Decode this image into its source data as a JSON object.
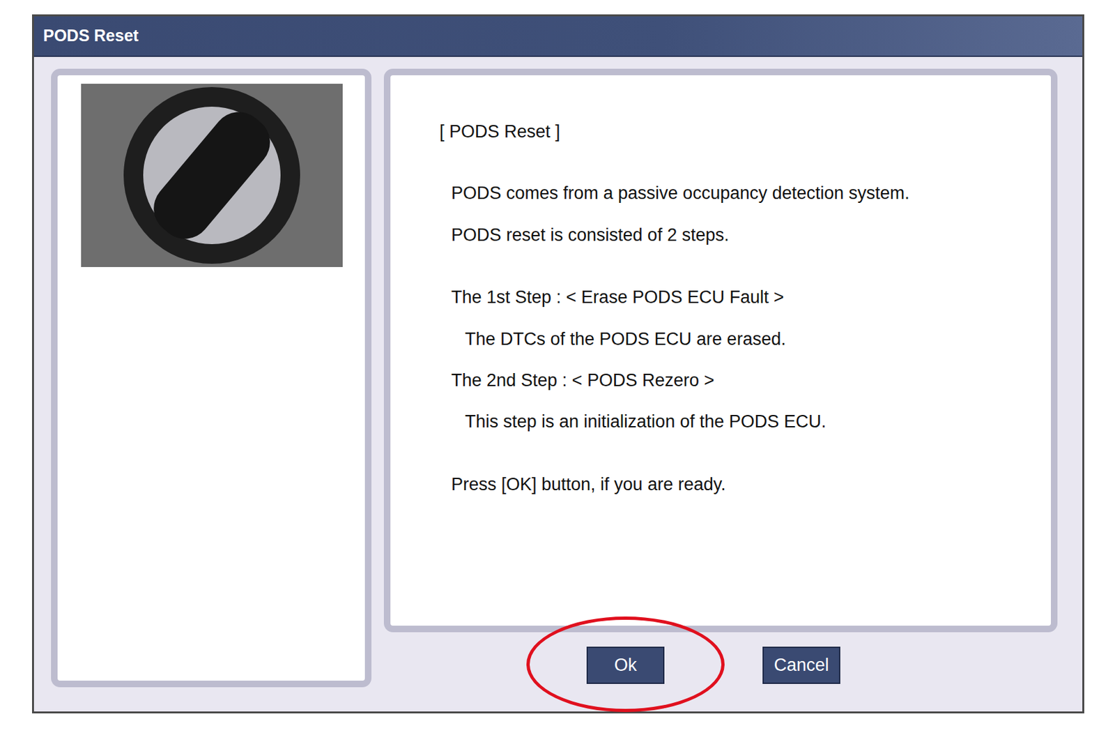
{
  "window": {
    "title": "PODS Reset"
  },
  "heading": "[ PODS Reset ]",
  "intro": [
    "PODS comes from a passive occupancy detection system.",
    "PODS reset is consisted of 2 steps."
  ],
  "steps": [
    {
      "title": "The 1st Step : < Erase PODS ECU Fault >",
      "description": "The DTCs of the PODS ECU are erased."
    },
    {
      "title": "The 2nd Step : < PODS Rezero >",
      "description": "This step is an initialization of the PODS ECU."
    }
  ],
  "prompt": "Press [OK] button, if you are ready.",
  "buttons": [
    {
      "label": "Ok",
      "highlighted": true
    },
    {
      "label": "Cancel",
      "highlighted": false
    }
  ]
}
